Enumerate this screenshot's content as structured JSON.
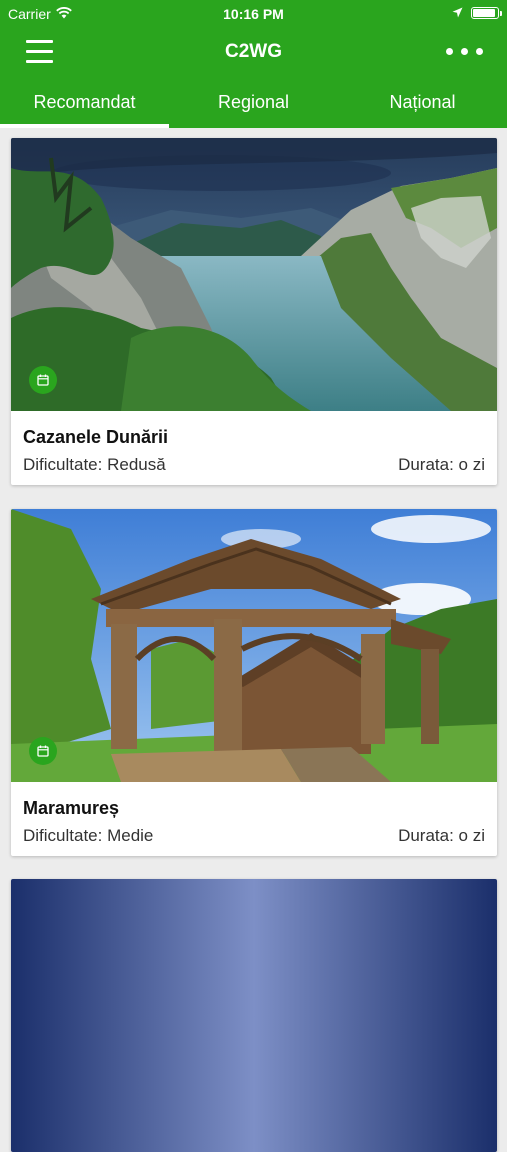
{
  "status_bar": {
    "carrier": "Carrier",
    "time": "10:16 PM"
  },
  "nav": {
    "title": "C2WG"
  },
  "tabs": [
    {
      "label": "Recomandat",
      "active": true
    },
    {
      "label": "Regional",
      "active": false
    },
    {
      "label": "Național",
      "active": false
    }
  ],
  "cards": [
    {
      "title": "Cazanele Dunării",
      "difficulty": "Dificultate: Redusă",
      "duration": "Durata: o zi"
    },
    {
      "title": "Maramureș",
      "difficulty": "Dificultate: Medie",
      "duration": "Durata: o zi"
    }
  ],
  "colors": {
    "brand": "#2aa51e"
  },
  "icons": [
    "hamburger-menu-icon",
    "more-icon",
    "calendar-icon",
    "wifi-icon",
    "location-arrow-icon",
    "battery-icon"
  ]
}
